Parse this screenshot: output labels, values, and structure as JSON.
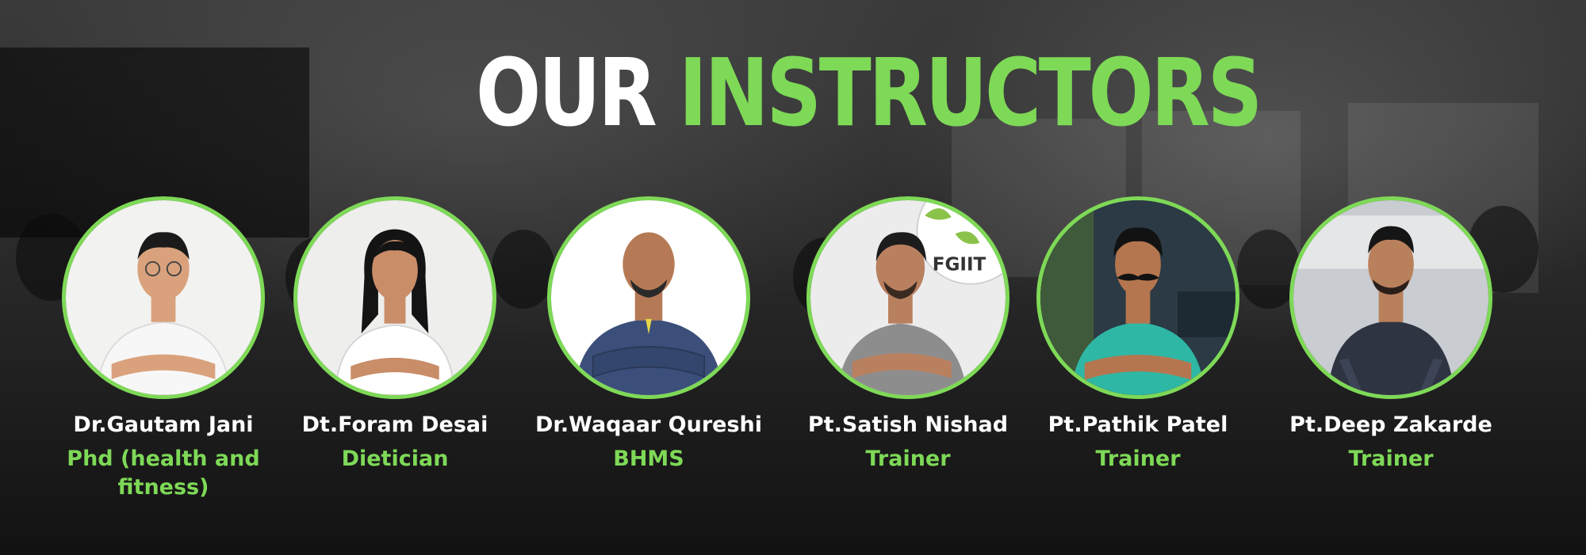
{
  "heading": {
    "part1": "OUR",
    "part2": "INSTRUCTORS"
  },
  "colors": {
    "accent": "#7ed957",
    "text": "#ffffff"
  },
  "instructors": [
    {
      "name": "Dr.Gautam Jani",
      "role": "Phd (health and fitness)",
      "photo_bg": "#f2f2f0",
      "shirt": "#f7f7f7",
      "skin": "#d9a27c",
      "hair": "#1a1a1a"
    },
    {
      "name": "Dt.Foram Desai",
      "role": "Dietician",
      "photo_bg": "#eeeeec",
      "shirt": "#ffffff",
      "skin": "#c98d68",
      "hair": "#141414"
    },
    {
      "name": "Dr.Waqaar Qureshi",
      "role": "BHMS",
      "photo_bg": "#ffffff",
      "shirt": "#3b4f7a",
      "skin": "#b57a55",
      "hair": "#2a2a2a"
    },
    {
      "name": "Pt.Satish Nishad",
      "role": "Trainer",
      "photo_bg": "#ececec",
      "shirt": "#8d8d8d",
      "skin": "#b98060",
      "hair": "#1c1c1c",
      "sign_text": "FGIIT"
    },
    {
      "name": "Pt.Pathik  Patel",
      "role": "Trainer",
      "photo_bg": "#2b3a44",
      "shirt": "#2fb7a6",
      "skin": "#b5764f",
      "hair": "#121212"
    },
    {
      "name": "Pt.Deep Zakarde",
      "role": "Trainer",
      "photo_bg": "#c9ccd0",
      "shirt": "#2e3442",
      "skin": "#b9805c",
      "hair": "#151515"
    }
  ]
}
